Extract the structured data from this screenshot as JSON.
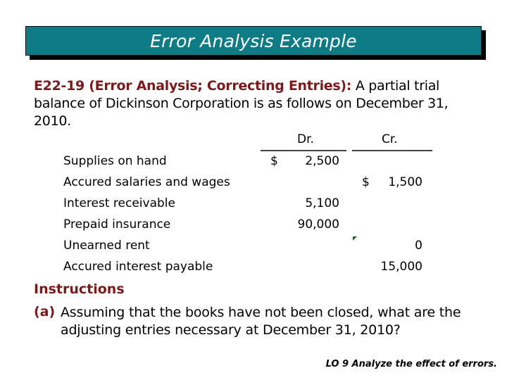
{
  "slide": {
    "title": "Error Analysis Example",
    "intro": {
      "exercise_ref": "E22-19 (Error Analysis; Correcting Entries):",
      "text": " A partial trial balance of Dickinson Corporation is as follows on December 31, 2010."
    },
    "table": {
      "columns": {
        "debit": "Dr.",
        "credit": "Cr."
      },
      "currency_symbol": "$",
      "rows": [
        {
          "account": "Supplies on hand",
          "debit": "2,500",
          "credit": "",
          "debit_symbol": "$",
          "credit_symbol": ""
        },
        {
          "account": "Accured salaries and wages",
          "debit": "",
          "credit": "1,500",
          "debit_symbol": "",
          "credit_symbol": "$"
        },
        {
          "account": "Interest receivable",
          "debit": "5,100",
          "credit": "",
          "debit_symbol": "",
          "credit_symbol": ""
        },
        {
          "account": "Prepaid insurance",
          "debit": "90,000",
          "credit": "",
          "debit_symbol": "",
          "credit_symbol": ""
        },
        {
          "account": "Unearned rent",
          "debit": "",
          "credit": "0",
          "debit_symbol": "",
          "credit_symbol": ""
        },
        {
          "account": "Accured interest payable",
          "debit": "",
          "credit": "15,000",
          "debit_symbol": "",
          "credit_symbol": ""
        }
      ]
    },
    "instructions": {
      "heading": "Instructions",
      "items": [
        {
          "marker": "(a)",
          "text": "Assuming that the books have not been closed, what are the adjusting entries necessary at December 31, 2010?"
        }
      ]
    },
    "footer": "LO 9 Analyze the effect of errors."
  },
  "colors": {
    "title_bar": "#0e7b85",
    "accent_text": "#7b1a1a",
    "error_marker": "#1e6b1e"
  }
}
